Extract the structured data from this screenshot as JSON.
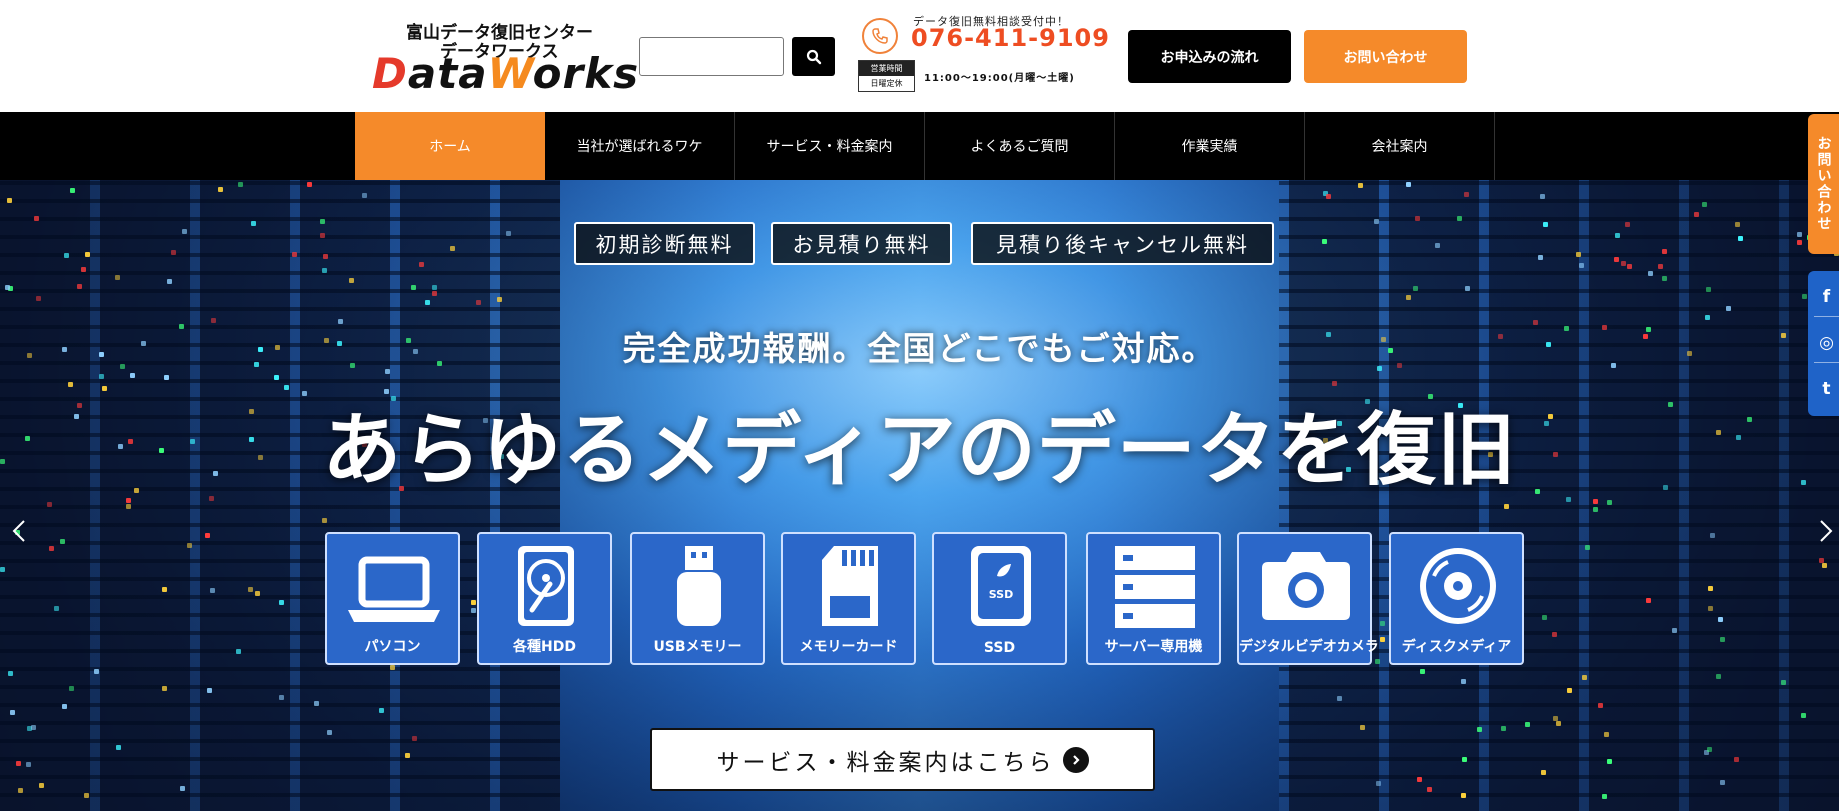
{
  "header": {
    "logo_line1": "富山データ復旧センター",
    "logo_line2": "データワークス",
    "logo_word_part1": "D",
    "logo_word_part2": "ata",
    "logo_word_part3": "W",
    "logo_word_part4": "orks",
    "search_value": "",
    "consult_text": "データ復旧無料相談受付中！",
    "phone": "076-411-9109",
    "hours_label_top": "営業時間",
    "hours_label_bottom": "日曜定休",
    "hours": "11:00～19:00(月曜～土曜)",
    "flow_button": "お申込みの流れ",
    "contact_button": "お問い合わせ"
  },
  "nav": {
    "items": [
      "ホーム",
      "当社が選ばれるワケ",
      "サービス・料金案内",
      "よくあるご質問",
      "作業実績",
      "会社案内"
    ]
  },
  "hero": {
    "badges": [
      "初期診断無料",
      "お見積り無料",
      "見積り後キャンセル無料"
    ],
    "subtitle": "完全成功報酬。全国どこでもご対応。",
    "title": "あらゆるメディアのデータを復旧",
    "media": [
      "パソコン",
      "各種HDD",
      "USBメモリー",
      "メモリーカード",
      "SSD",
      "サーバー専用機",
      "デジタルビデオカメラ",
      "ディスクメディア"
    ],
    "ssd_icon_text": "SSD",
    "cta": "サービス・料金案内はこちら"
  },
  "side": {
    "contact": "お問い合わせ",
    "social": [
      "f",
      "◎",
      "t"
    ]
  },
  "colors": {
    "accent_orange": "#f58a2a",
    "phone_red": "#ee4d22",
    "card_blue": "#2b67c9",
    "social_blue": "#1f63c8"
  }
}
